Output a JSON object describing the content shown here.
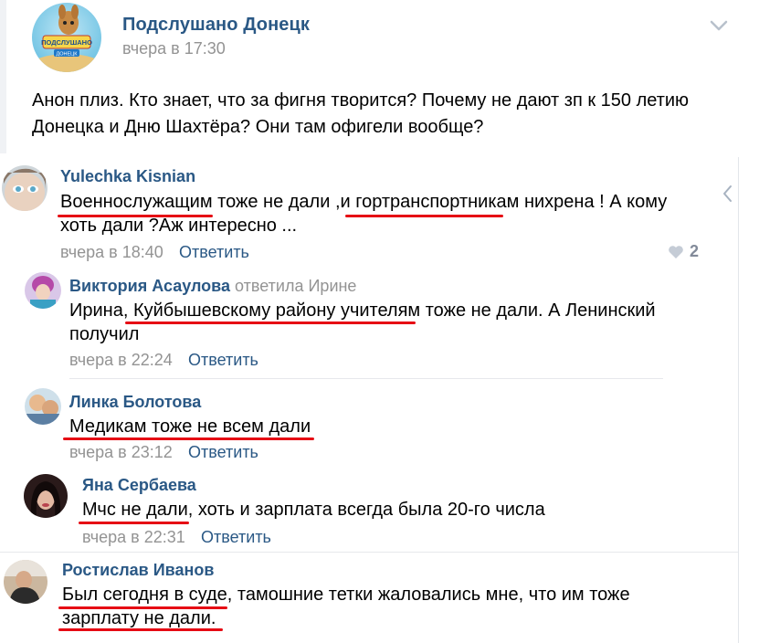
{
  "post": {
    "group_name": "Подслушано Донецк",
    "date": "вчера в 17:30",
    "text": "Анон плиз. Кто знает, что за фигня творится? Почему не дают зп к 150 летию Донецка и Дню Шахтёра? Они там офигели вообще?",
    "avatar_text_top": "ПОДСЛУШАНО",
    "avatar_text_bottom": "ДОНЕЦК"
  },
  "comments": [
    {
      "name": "Yulechka Kisnian",
      "text_line1": "Военнослужащим тоже не дали ,и гортранспортникам нихрена ! А кому",
      "text_line2": "хоть дали ?Аж интересно ...",
      "date": "вчера в 18:40",
      "reply": "Ответить",
      "likes": "2"
    },
    {
      "name": "Виктория Асаулова",
      "replied_to": "ответила Ирине",
      "text_line1": "Ирина, Куйбышевскому району учителям тоже не дали. А Ленинский",
      "text_line2": "получил",
      "date": "вчера в 22:24",
      "reply": "Ответить"
    },
    {
      "name": "Линка Болотова",
      "text_line1": "Медикам тоже не всем дали",
      "date": "вчера в 23:12",
      "reply": "Ответить"
    },
    {
      "name": "Яна Сербаева",
      "text_line1": "Мчс не дали, хоть и зарплата всегда была 20-го числа",
      "date": "вчера в 22:31",
      "reply": "Ответить"
    },
    {
      "name": "Ростислав Иванов",
      "text_line1": "Был сегодня в суде, тамошние тетки жаловались мне, что им тоже",
      "text_line2": "зарплату не дали."
    }
  ],
  "colors": {
    "link": "#2a5885",
    "meta": "#939393",
    "underline": "#e60b14"
  },
  "icons": {
    "chevron": "chevron-down-icon",
    "collapse": "chevron-left-icon",
    "like": "heart-icon"
  }
}
